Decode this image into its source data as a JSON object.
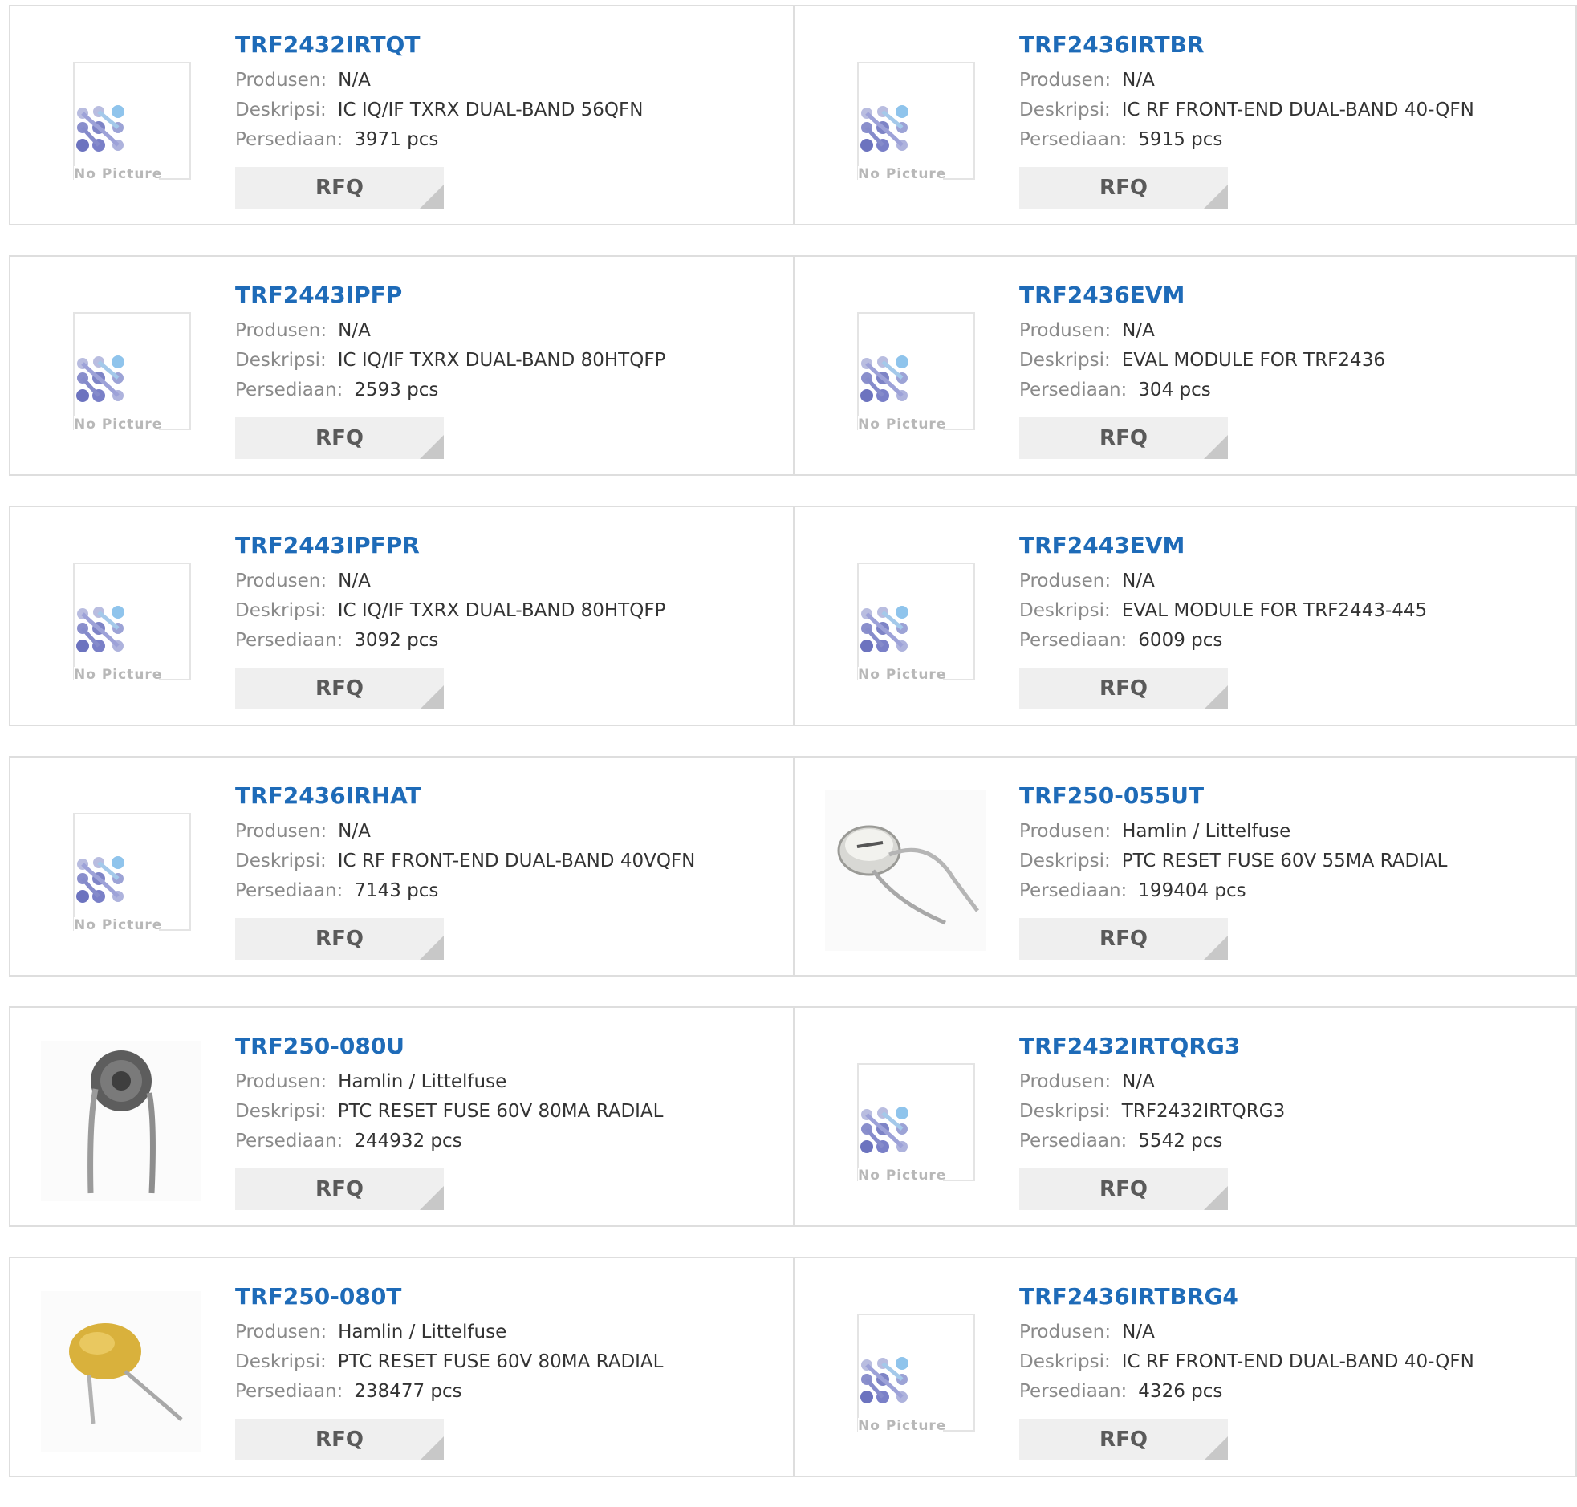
{
  "labels": {
    "manufacturer": "Produsen:",
    "description": "Deskripsi:",
    "stock": "Persediaan:",
    "rfq": "RFQ",
    "no_picture": "No Picture"
  },
  "colors": {
    "title_link": "#1e6bb8",
    "border": "#dedede",
    "rfq_bg": "#efefef"
  },
  "products": [
    {
      "part": "TRF2432IRTQT",
      "manufacturer": "N/A",
      "description": "IC IQ/IF TXRX DUAL-BAND 56QFN",
      "stock": "3971 pcs",
      "image": "no-picture"
    },
    {
      "part": "TRF2436IRTBR",
      "manufacturer": "N/A",
      "description": "IC RF FRONT-END DUAL-BAND 40-QFN",
      "stock": "5915 pcs",
      "image": "no-picture"
    },
    {
      "part": "TRF2443IPFP",
      "manufacturer": "N/A",
      "description": "IC IQ/IF TXRX DUAL-BAND 80HTQFP",
      "stock": "2593 pcs",
      "image": "no-picture"
    },
    {
      "part": "TRF2436EVM",
      "manufacturer": "N/A",
      "description": "EVAL MODULE FOR TRF2436",
      "stock": "304 pcs",
      "image": "no-picture"
    },
    {
      "part": "TRF2443IPFPR",
      "manufacturer": "N/A",
      "description": "IC IQ/IF TXRX DUAL-BAND 80HTQFP",
      "stock": "3092 pcs",
      "image": "no-picture"
    },
    {
      "part": "TRF2443EVM",
      "manufacturer": "N/A",
      "description": "EVAL MODULE FOR TRF2443-445",
      "stock": "6009 pcs",
      "image": "no-picture"
    },
    {
      "part": "TRF2436IRHAT",
      "manufacturer": "N/A",
      "description": "IC RF FRONT-END DUAL-BAND 40VQFN",
      "stock": "7143 pcs",
      "image": "no-picture"
    },
    {
      "part": "TRF250-055UT",
      "manufacturer": "Hamlin / Littelfuse",
      "description": "PTC RESET FUSE 60V 55MA RADIAL",
      "stock": "199404 pcs",
      "image": "fuse-silver"
    },
    {
      "part": "TRF250-080U",
      "manufacturer": "Hamlin / Littelfuse",
      "description": "PTC RESET FUSE 60V 80MA RADIAL",
      "stock": "244932 pcs",
      "image": "fuse-dark"
    },
    {
      "part": "TRF2432IRTQRG3",
      "manufacturer": "N/A",
      "description": "TRF2432IRTQRG3",
      "stock": "5542 pcs",
      "image": "no-picture"
    },
    {
      "part": "TRF250-080T",
      "manufacturer": "Hamlin / Littelfuse",
      "description": "PTC RESET FUSE 60V 80MA RADIAL",
      "stock": "238477 pcs",
      "image": "fuse-yellow"
    },
    {
      "part": "TRF2436IRTBRG4",
      "manufacturer": "N/A",
      "description": "IC RF FRONT-END DUAL-BAND 40-QFN",
      "stock": "4326 pcs",
      "image": "no-picture"
    }
  ]
}
